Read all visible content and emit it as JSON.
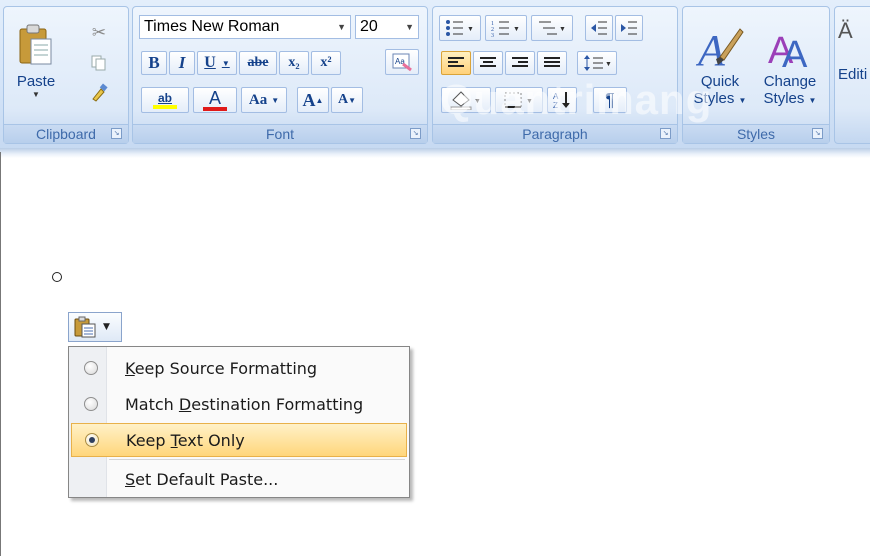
{
  "ribbon": {
    "clipboard": {
      "label": "Clipboard",
      "paste_label": "Paste"
    },
    "font": {
      "label": "Font",
      "font_name": "Times New Roman",
      "font_size": "20",
      "bold": "B",
      "italic": "I",
      "underline": "U",
      "strikethrough": "abe",
      "subscript": "x₂",
      "superscript": "x²",
      "change_case": "Aa",
      "grow_font": "A",
      "shrink_font": "A",
      "font_color": "A",
      "highlight": "ab"
    },
    "paragraph": {
      "label": "Paragraph",
      "show_marks": "¶"
    },
    "styles": {
      "label": "Styles",
      "quick_styles": [
        "Quick",
        "Styles"
      ],
      "change_styles": [
        "Change",
        "Styles"
      ]
    },
    "editing": {
      "label": "Editi"
    }
  },
  "watermark": "Quantrimang",
  "paste_menu": {
    "items": [
      {
        "pre": "",
        "accel": "K",
        "post": "eep Source Formatting",
        "selected": false
      },
      {
        "pre": "Match ",
        "accel": "D",
        "post": "estination Formatting",
        "selected": false
      },
      {
        "pre": "Keep ",
        "accel": "T",
        "post": "ext Only",
        "selected": true
      },
      {
        "pre": "",
        "accel": "S",
        "post": "et Default Paste...",
        "selected": false
      }
    ]
  },
  "colors": {
    "ribbon_bg": "#d4e4f8",
    "highlight": "#ffd67b",
    "font_color_bar": "#e01a1a",
    "highlight_color_bar": "#ffff00"
  }
}
